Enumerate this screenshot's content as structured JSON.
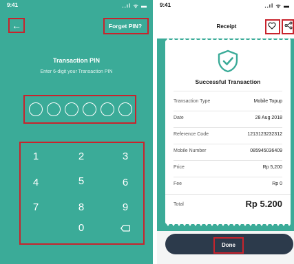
{
  "pin_screen": {
    "status_time": "9:41",
    "status_icons": "..ıl ᯤ ▬",
    "back_icon": "arrow-left-icon",
    "forgot_label": "Forget PIN?",
    "title": "Transaction PIN",
    "subtitle": "Enter 6-digit your Transaction PIN",
    "pin_slots": 6,
    "keys": [
      "1",
      "2",
      "3",
      "4",
      "5",
      "6",
      "7",
      "8",
      "9",
      "0"
    ],
    "backspace_icon": "backspace-icon",
    "background_color": "#3bab98"
  },
  "receipt_screen": {
    "status_time": "9:41",
    "status_icons": "..ıl ᯤ ▬",
    "title": "Receipt",
    "heart_icon": "heart-icon",
    "share_icon": "share-icon",
    "shield_icon": "shield-check-icon",
    "success_title": "Successful Transaction",
    "rows": [
      {
        "label": "Transaction Type",
        "value": "Mobile Topup"
      },
      {
        "label": "Date",
        "value": "28 Aug 2018"
      },
      {
        "label": "Reference Code",
        "value": "1213123232312"
      },
      {
        "label": "Mobile Number",
        "value": "085945036409"
      },
      {
        "label": "Price",
        "value": "Rp 5,200"
      },
      {
        "label": "Fee",
        "value": "Rp 0"
      }
    ],
    "total_label": "Total",
    "total_value": "Rp 5.200",
    "done_label": "Done",
    "accent_color": "#3bab98",
    "button_color": "#2c3a4b"
  },
  "annotation_color": "#c8232c"
}
